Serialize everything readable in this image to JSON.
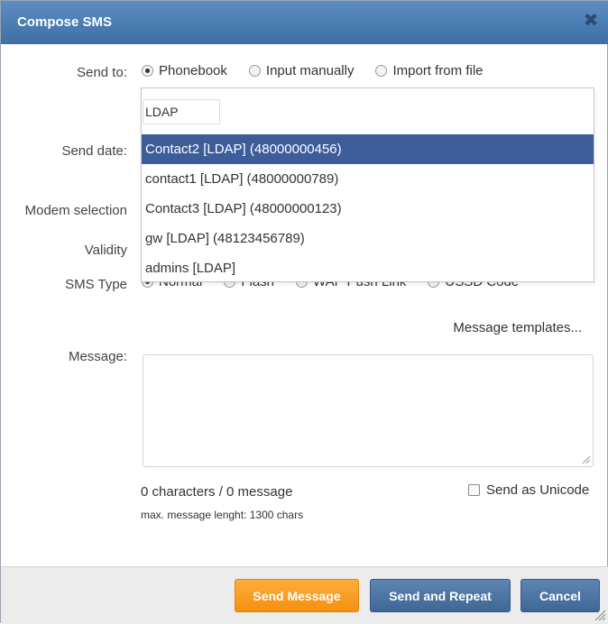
{
  "dialog": {
    "title": "Compose SMS"
  },
  "form": {
    "send_to_label": "Send to:",
    "send_to_options": [
      "Phonebook",
      "Input manually",
      "Import from file"
    ],
    "send_to_selected": "Phonebook",
    "send_date_label": "Send date:",
    "modem_label": "Modem selection",
    "validity_label": "Validity",
    "sms_type_label": "SMS Type",
    "sms_type_options": [
      "Normal",
      "Flash",
      "WAP Push Link",
      "USSD Code"
    ],
    "message_templates_link": "Message templates...",
    "message_label": "Message:",
    "message_value": "",
    "char_count": "0 characters / 0 message",
    "max_length_note": "max. message lenght: 1300 chars",
    "unicode_label": "Send as Unicode",
    "unicode_checked": false
  },
  "phonebook_dropdown": {
    "search_value": "LDAP",
    "options": [
      "Contact2 [LDAP] (48000000456)",
      "contact1 [LDAP] (48000000789)",
      "Contact3 [LDAP] (48000000123)",
      "gw [LDAP] (48123456789)",
      "admins [LDAP]"
    ],
    "highlighted_index": 0
  },
  "footer": {
    "send_label": "Send Message",
    "repeat_label": "Send and Repeat",
    "cancel_label": "Cancel"
  },
  "colors": {
    "titlebar": "#4a7db3",
    "highlight": "#3c5c9a",
    "send_button": "#f7a12a",
    "secondary_button": "#4b71a0"
  }
}
